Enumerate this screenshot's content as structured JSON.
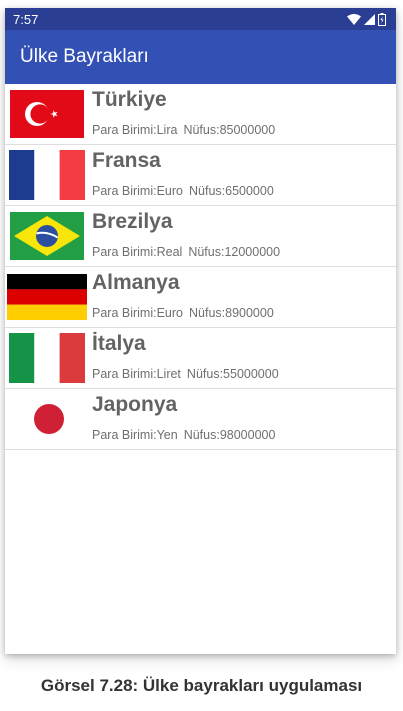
{
  "status_bar": {
    "time": "7:57",
    "icons": [
      "wifi-icon",
      "signal-icon",
      "battery-icon"
    ]
  },
  "app_bar": {
    "title": "Ülke Bayrakları",
    "color": "#3350b5"
  },
  "countries": [
    {
      "name": "Türkiye",
      "currency": "Para Birimi:Lira",
      "population": "Nüfus:85000000",
      "flag": "turkey-flag-icon"
    },
    {
      "name": "Fransa",
      "currency": "Para Birimi:Euro",
      "population": "Nüfus:6500000",
      "flag": "france-flag-icon"
    },
    {
      "name": "Brezilya",
      "currency": "Para Birimi:Real",
      "population": "Nüfus:12000000",
      "flag": "brazil-flag-icon"
    },
    {
      "name": "Almanya",
      "currency": "Para Birimi:Euro",
      "population": "Nüfus:8900000",
      "flag": "germany-flag-icon"
    },
    {
      "name": "İtalya",
      "currency": "Para Birimi:Liret",
      "population": "Nüfus:55000000",
      "flag": "italy-flag-icon"
    },
    {
      "name": "Japonya",
      "currency": "Para Birimi:Yen",
      "population": "Nüfus:98000000",
      "flag": "japan-flag-icon"
    }
  ],
  "caption": "Görsel 7.28: Ülke bayrakları uygulaması"
}
